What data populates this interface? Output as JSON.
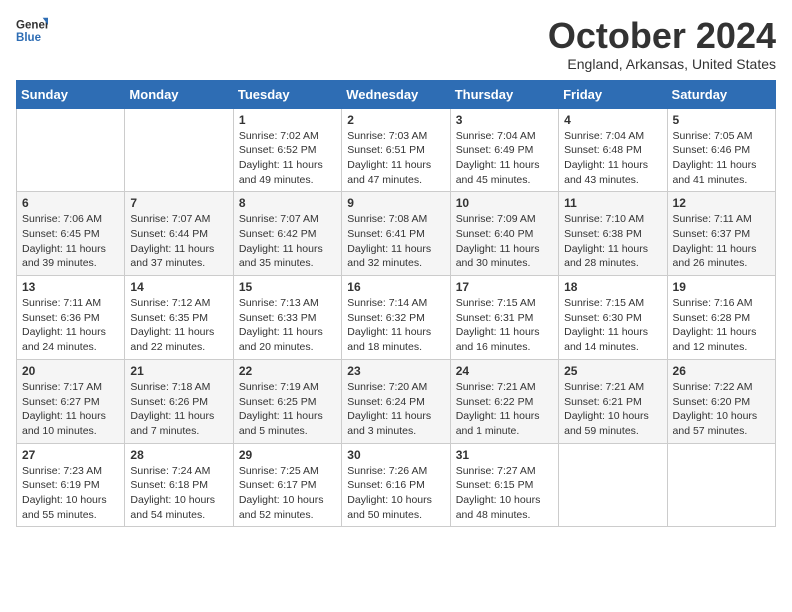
{
  "logo": {
    "line1": "General",
    "line2": "Blue"
  },
  "title": "October 2024",
  "subtitle": "England, Arkansas, United States",
  "days_of_week": [
    "Sunday",
    "Monday",
    "Tuesday",
    "Wednesday",
    "Thursday",
    "Friday",
    "Saturday"
  ],
  "weeks": [
    [
      {
        "day": "",
        "info": ""
      },
      {
        "day": "",
        "info": ""
      },
      {
        "day": "1",
        "info": "Sunrise: 7:02 AM\nSunset: 6:52 PM\nDaylight: 11 hours and 49 minutes."
      },
      {
        "day": "2",
        "info": "Sunrise: 7:03 AM\nSunset: 6:51 PM\nDaylight: 11 hours and 47 minutes."
      },
      {
        "day": "3",
        "info": "Sunrise: 7:04 AM\nSunset: 6:49 PM\nDaylight: 11 hours and 45 minutes."
      },
      {
        "day": "4",
        "info": "Sunrise: 7:04 AM\nSunset: 6:48 PM\nDaylight: 11 hours and 43 minutes."
      },
      {
        "day": "5",
        "info": "Sunrise: 7:05 AM\nSunset: 6:46 PM\nDaylight: 11 hours and 41 minutes."
      }
    ],
    [
      {
        "day": "6",
        "info": "Sunrise: 7:06 AM\nSunset: 6:45 PM\nDaylight: 11 hours and 39 minutes."
      },
      {
        "day": "7",
        "info": "Sunrise: 7:07 AM\nSunset: 6:44 PM\nDaylight: 11 hours and 37 minutes."
      },
      {
        "day": "8",
        "info": "Sunrise: 7:07 AM\nSunset: 6:42 PM\nDaylight: 11 hours and 35 minutes."
      },
      {
        "day": "9",
        "info": "Sunrise: 7:08 AM\nSunset: 6:41 PM\nDaylight: 11 hours and 32 minutes."
      },
      {
        "day": "10",
        "info": "Sunrise: 7:09 AM\nSunset: 6:40 PM\nDaylight: 11 hours and 30 minutes."
      },
      {
        "day": "11",
        "info": "Sunrise: 7:10 AM\nSunset: 6:38 PM\nDaylight: 11 hours and 28 minutes."
      },
      {
        "day": "12",
        "info": "Sunrise: 7:11 AM\nSunset: 6:37 PM\nDaylight: 11 hours and 26 minutes."
      }
    ],
    [
      {
        "day": "13",
        "info": "Sunrise: 7:11 AM\nSunset: 6:36 PM\nDaylight: 11 hours and 24 minutes."
      },
      {
        "day": "14",
        "info": "Sunrise: 7:12 AM\nSunset: 6:35 PM\nDaylight: 11 hours and 22 minutes."
      },
      {
        "day": "15",
        "info": "Sunrise: 7:13 AM\nSunset: 6:33 PM\nDaylight: 11 hours and 20 minutes."
      },
      {
        "day": "16",
        "info": "Sunrise: 7:14 AM\nSunset: 6:32 PM\nDaylight: 11 hours and 18 minutes."
      },
      {
        "day": "17",
        "info": "Sunrise: 7:15 AM\nSunset: 6:31 PM\nDaylight: 11 hours and 16 minutes."
      },
      {
        "day": "18",
        "info": "Sunrise: 7:15 AM\nSunset: 6:30 PM\nDaylight: 11 hours and 14 minutes."
      },
      {
        "day": "19",
        "info": "Sunrise: 7:16 AM\nSunset: 6:28 PM\nDaylight: 11 hours and 12 minutes."
      }
    ],
    [
      {
        "day": "20",
        "info": "Sunrise: 7:17 AM\nSunset: 6:27 PM\nDaylight: 11 hours and 10 minutes."
      },
      {
        "day": "21",
        "info": "Sunrise: 7:18 AM\nSunset: 6:26 PM\nDaylight: 11 hours and 7 minutes."
      },
      {
        "day": "22",
        "info": "Sunrise: 7:19 AM\nSunset: 6:25 PM\nDaylight: 11 hours and 5 minutes."
      },
      {
        "day": "23",
        "info": "Sunrise: 7:20 AM\nSunset: 6:24 PM\nDaylight: 11 hours and 3 minutes."
      },
      {
        "day": "24",
        "info": "Sunrise: 7:21 AM\nSunset: 6:22 PM\nDaylight: 11 hours and 1 minute."
      },
      {
        "day": "25",
        "info": "Sunrise: 7:21 AM\nSunset: 6:21 PM\nDaylight: 10 hours and 59 minutes."
      },
      {
        "day": "26",
        "info": "Sunrise: 7:22 AM\nSunset: 6:20 PM\nDaylight: 10 hours and 57 minutes."
      }
    ],
    [
      {
        "day": "27",
        "info": "Sunrise: 7:23 AM\nSunset: 6:19 PM\nDaylight: 10 hours and 55 minutes."
      },
      {
        "day": "28",
        "info": "Sunrise: 7:24 AM\nSunset: 6:18 PM\nDaylight: 10 hours and 54 minutes."
      },
      {
        "day": "29",
        "info": "Sunrise: 7:25 AM\nSunset: 6:17 PM\nDaylight: 10 hours and 52 minutes."
      },
      {
        "day": "30",
        "info": "Sunrise: 7:26 AM\nSunset: 6:16 PM\nDaylight: 10 hours and 50 minutes."
      },
      {
        "day": "31",
        "info": "Sunrise: 7:27 AM\nSunset: 6:15 PM\nDaylight: 10 hours and 48 minutes."
      },
      {
        "day": "",
        "info": ""
      },
      {
        "day": "",
        "info": ""
      }
    ]
  ]
}
